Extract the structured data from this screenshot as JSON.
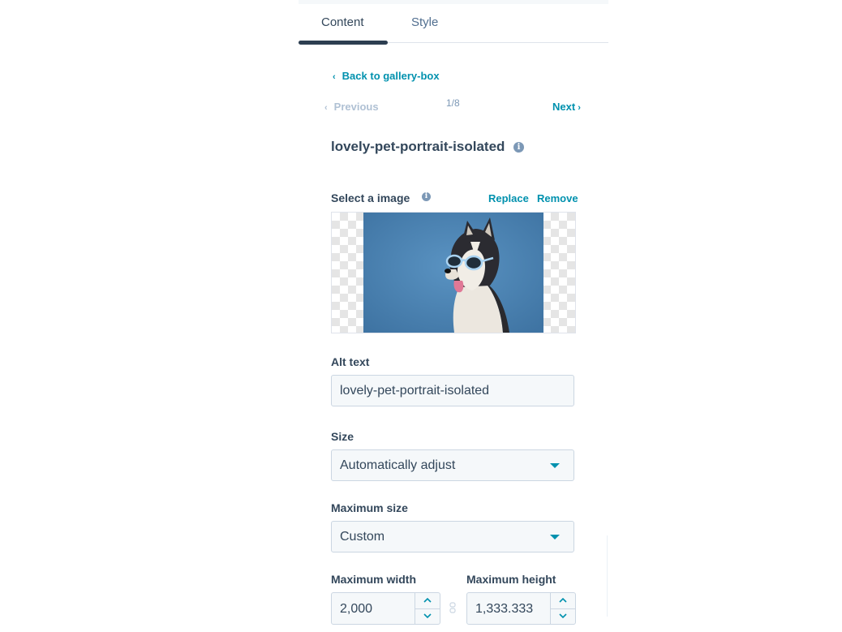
{
  "tabs": [
    {
      "label": "Content",
      "active": true
    },
    {
      "label": "Style",
      "active": false
    }
  ],
  "back_link": {
    "label": "Back to gallery-box",
    "icon": "chevron-left-icon"
  },
  "pager": {
    "previous_label": "Previous",
    "position": "1/8",
    "next_label": "Next"
  },
  "item": {
    "title": "lovely-pet-portrait-isolated"
  },
  "image_field": {
    "label": "Select a image",
    "replace_label": "Replace",
    "remove_label": "Remove",
    "image_description": "husky wearing sunglasses on blue background"
  },
  "alt_text": {
    "label": "Alt text",
    "value": "lovely-pet-portrait-isolated"
  },
  "size": {
    "label": "Size",
    "selected": "Automatically adjust"
  },
  "max_size": {
    "label": "Maximum size",
    "selected": "Custom"
  },
  "max_width": {
    "label": "Maximum width",
    "value": "2,000"
  },
  "max_height": {
    "label": "Maximum height",
    "value": "1,333.333"
  },
  "colors": {
    "accent": "#0091ae",
    "text": "#33475b",
    "muted": "#7c98b6",
    "input_bg": "#f5f8fa",
    "border": "#cbd6e2"
  }
}
